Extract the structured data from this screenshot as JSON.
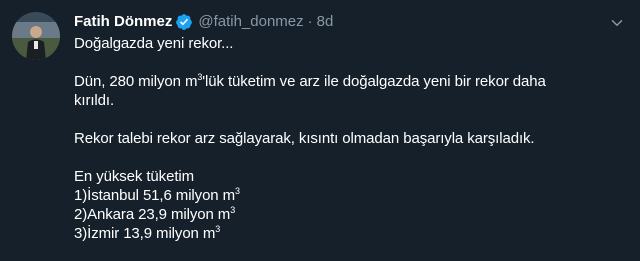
{
  "author": {
    "name": "Fatih Dönmez",
    "handle": "@fatih_donmez",
    "separator": "·",
    "time": "8d"
  },
  "icons": {
    "verified": "verified-badge-icon",
    "more": "chevron-down-icon",
    "avatar": "profile-photo"
  },
  "colors": {
    "background": "#15202b",
    "text": "#ffffff",
    "muted": "#8899a6",
    "verified": "#1da1f2"
  },
  "tweet": {
    "line1": "Doğalgazda yeni rekor...",
    "line2_before": "Dün, 280 milyon m",
    "line2_sup": "3",
    "line2_after": "'lük tüketim ve arz ile doğalgazda yeni bir rekor daha",
    "line3": "kırıldı.",
    "line4": "Rekor talebi rekor arz sağlayarak, kısıntı olmadan başarıyla karşıladık.",
    "line5": "En yüksek tüketim",
    "list": [
      {
        "text": "1)İstanbul 51,6 milyon m",
        "sup": "3"
      },
      {
        "text": "2)Ankara 23,9 milyon m",
        "sup": "3"
      },
      {
        "text": "3)İzmir 13,9 milyon m",
        "sup": "3"
      }
    ]
  }
}
